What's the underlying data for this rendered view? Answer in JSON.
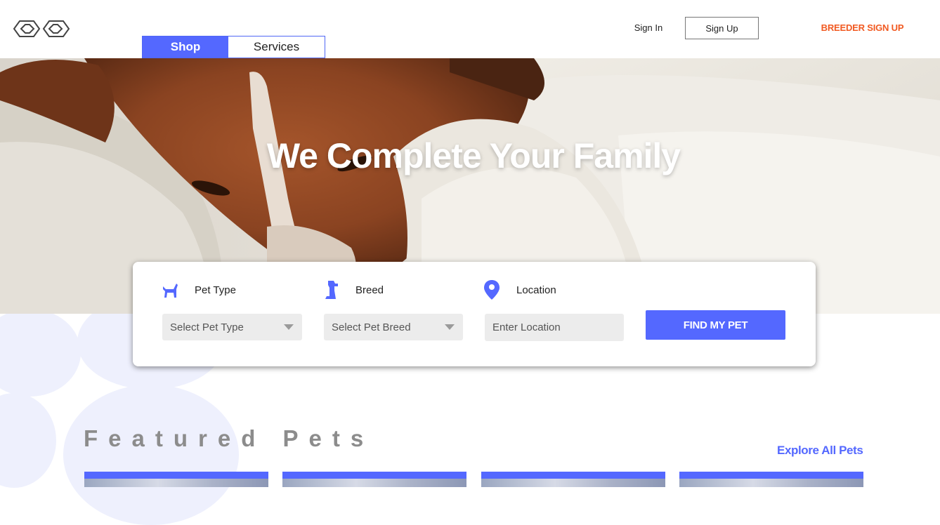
{
  "header": {
    "logo_name": "infinity-logo",
    "tabs": [
      {
        "label": "Shop",
        "active": true
      },
      {
        "label": "Services",
        "active": false
      }
    ],
    "sign_in": "Sign In",
    "sign_up": "Sign Up",
    "breeder_sign_up": "BREEDER SIGN UP"
  },
  "hero": {
    "title": "We Complete Your Family"
  },
  "search": {
    "pet_type": {
      "label": "Pet Type",
      "icon": "dog-icon",
      "placeholder": "Select Pet Type"
    },
    "breed": {
      "label": "Breed",
      "icon": "sitting-dog-icon",
      "placeholder": "Select Pet Breed"
    },
    "location": {
      "label": "Location",
      "icon": "location-pin-icon",
      "placeholder": "Enter Location"
    },
    "find_button": "FIND MY PET"
  },
  "featured": {
    "title": "Featured Pets",
    "explore_link": "Explore All Pets",
    "card_count": 4
  },
  "colors": {
    "accent": "#5468ff",
    "breeder": "#f15a22",
    "paw": "#eef0fd"
  }
}
